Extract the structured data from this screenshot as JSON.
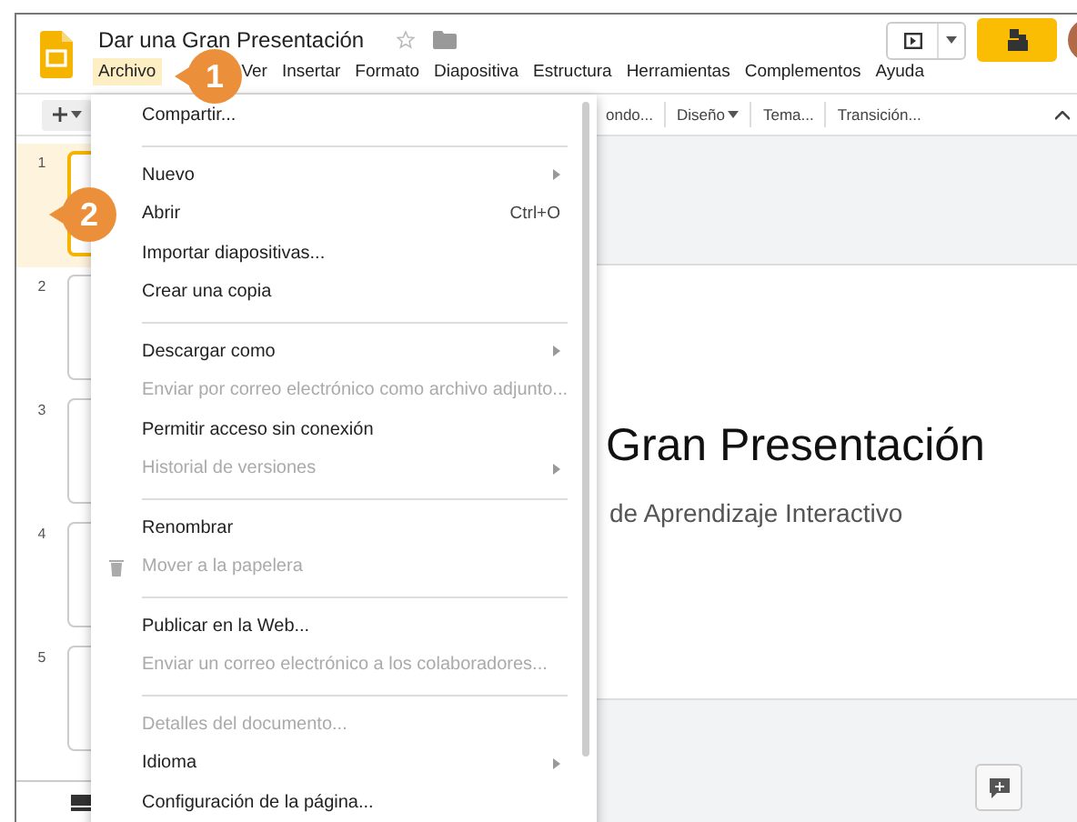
{
  "document": {
    "title": "Dar una Gran Presentación",
    "starred": false
  },
  "menu_bar": [
    {
      "label": "Archivo",
      "selected": true
    },
    {
      "label": "Ver",
      "selected": false
    },
    {
      "label": "Insertar",
      "selected": false
    },
    {
      "label": "Formato",
      "selected": false
    },
    {
      "label": "Diapositiva",
      "selected": false
    },
    {
      "label": "Estructura",
      "selected": false
    },
    {
      "label": "Herramientas",
      "selected": false
    },
    {
      "label": "Complementos",
      "selected": false
    },
    {
      "label": "Ayuda",
      "selected": false
    }
  ],
  "toolbar": [
    {
      "label": "ondo...",
      "dropdown": false
    },
    {
      "label": "Diseño",
      "dropdown": true
    },
    {
      "label": "Tema...",
      "dropdown": false
    },
    {
      "label": "Transición...",
      "dropdown": false
    }
  ],
  "filmstrip": [
    {
      "number": "1",
      "selected": true
    },
    {
      "number": "2",
      "selected": false
    },
    {
      "number": "3",
      "selected": false
    },
    {
      "number": "4",
      "selected": false
    },
    {
      "number": "5",
      "selected": false
    }
  ],
  "slide": {
    "title": "Gran Presentación",
    "subtitle": "de Aprendizaje Interactivo"
  },
  "file_menu": [
    [
      {
        "label": "Compartir...",
        "kind": "plain",
        "disabled": false,
        "submenu": false
      }
    ],
    [
      {
        "label": "Nuevo",
        "kind": "plain",
        "disabled": false,
        "submenu": true
      },
      {
        "label": "Abrir",
        "kind": "plain",
        "disabled": false,
        "submenu": false,
        "shortcut": "Ctrl+O"
      },
      {
        "label": "Importar diapositivas...",
        "kind": "plain",
        "disabled": false,
        "submenu": false
      },
      {
        "label": "Crear una copia",
        "kind": "plain",
        "disabled": false,
        "submenu": false
      }
    ],
    [
      {
        "label": "Descargar como",
        "kind": "plain",
        "disabled": false,
        "submenu": true
      },
      {
        "label": "Enviar por correo electrónico como archivo adjunto...",
        "kind": "plain",
        "disabled": true,
        "submenu": false
      },
      {
        "label": "Permitir acceso sin conexión",
        "kind": "plain",
        "disabled": false,
        "submenu": false
      },
      {
        "label": "Historial de versiones",
        "kind": "plain",
        "disabled": true,
        "submenu": true
      }
    ],
    [
      {
        "label": "Renombrar",
        "kind": "plain",
        "disabled": false,
        "submenu": false
      },
      {
        "label": "Mover a la papelera",
        "kind": "trash",
        "disabled": true,
        "submenu": false
      }
    ],
    [
      {
        "label": "Publicar en la Web...",
        "kind": "plain",
        "disabled": false,
        "submenu": false
      },
      {
        "label": "Enviar un correo electrónico a los colaboradores...",
        "kind": "plain",
        "disabled": true,
        "submenu": false
      }
    ],
    [
      {
        "label": "Detalles del documento...",
        "kind": "plain",
        "disabled": true,
        "submenu": false
      },
      {
        "label": "Idioma",
        "kind": "plain",
        "disabled": false,
        "submenu": true
      },
      {
        "label": "Configuración de la página...",
        "kind": "plain",
        "disabled": false,
        "submenu": false
      }
    ]
  ],
  "callouts": [
    {
      "number": "1"
    },
    {
      "number": "2"
    }
  ]
}
